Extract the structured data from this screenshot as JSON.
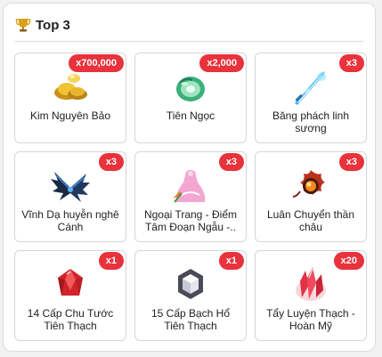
{
  "header": {
    "title": "Top 3",
    "icon": "trophy-icon"
  },
  "items": [
    {
      "qty": "x700,000",
      "name": "Kim Nguyên Bảo",
      "icon": "gold-ingot-icon"
    },
    {
      "qty": "x2,000",
      "name": "Tiên Ngọc",
      "icon": "jade-disc-icon"
    },
    {
      "qty": "x3",
      "name": "Băng phách linh sương",
      "icon": "ice-sword-icon"
    },
    {
      "qty": "x3",
      "name": "Vĩnh Dạ huyễn nghê Cánh",
      "icon": "dark-wings-icon"
    },
    {
      "qty": "x3",
      "name": "Ngoại Trang - Điểm Tâm Đoạn Ngẫu -..",
      "icon": "pink-dress-icon"
    },
    {
      "qty": "x3",
      "name": "Luân Chuyển thần châu",
      "icon": "fire-orb-icon"
    },
    {
      "qty": "x1",
      "name": "14 Cấp Chu Tước Tiên Thạch",
      "icon": "red-gem-icon"
    },
    {
      "qty": "x1",
      "name": "15 Cấp Bạch Hổ Tiên Thạch",
      "icon": "silver-gem-icon"
    },
    {
      "qty": "x20",
      "name": "Tẩy Luyện Thạch - Hoàn Mỹ",
      "icon": "red-crystal-icon"
    }
  ],
  "colors": {
    "badge": "#e8323c",
    "border": "#d6d6d6"
  }
}
